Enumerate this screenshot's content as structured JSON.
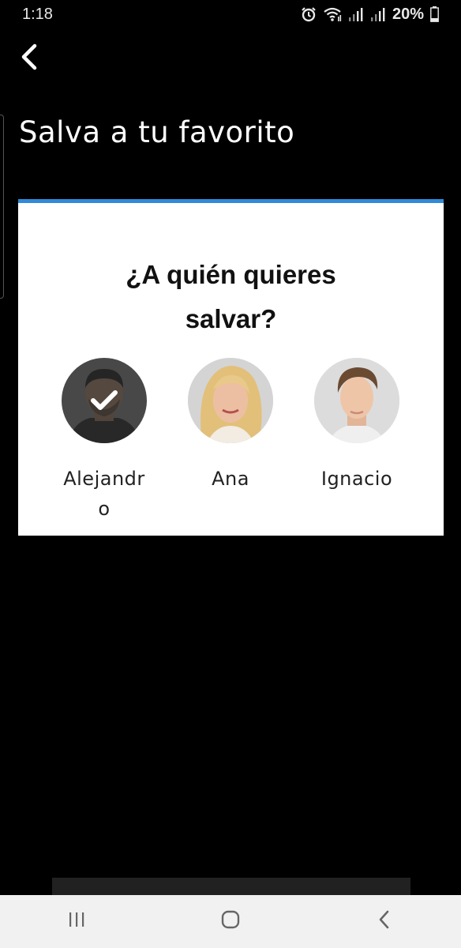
{
  "status_bar": {
    "time": "1:18",
    "battery": "20%",
    "icons": [
      "alarm-icon",
      "wifi-icon",
      "signal-icon",
      "signal-icon",
      "battery-icon"
    ]
  },
  "header": {
    "back_icon": "chevron-left-icon",
    "title": "Salva a tu favorito"
  },
  "poll": {
    "accent_color": "#2f8ad8",
    "question_line1": "¿A quién quieres",
    "question_line2": "salvar?",
    "candidates": [
      {
        "name": "Alejandro",
        "selected": true
      },
      {
        "name": "Ana",
        "selected": false
      },
      {
        "name": "Ignacio",
        "selected": false
      }
    ]
  },
  "nav_bar": {
    "items": [
      "recent-apps-icon",
      "home-icon",
      "back-icon"
    ]
  }
}
